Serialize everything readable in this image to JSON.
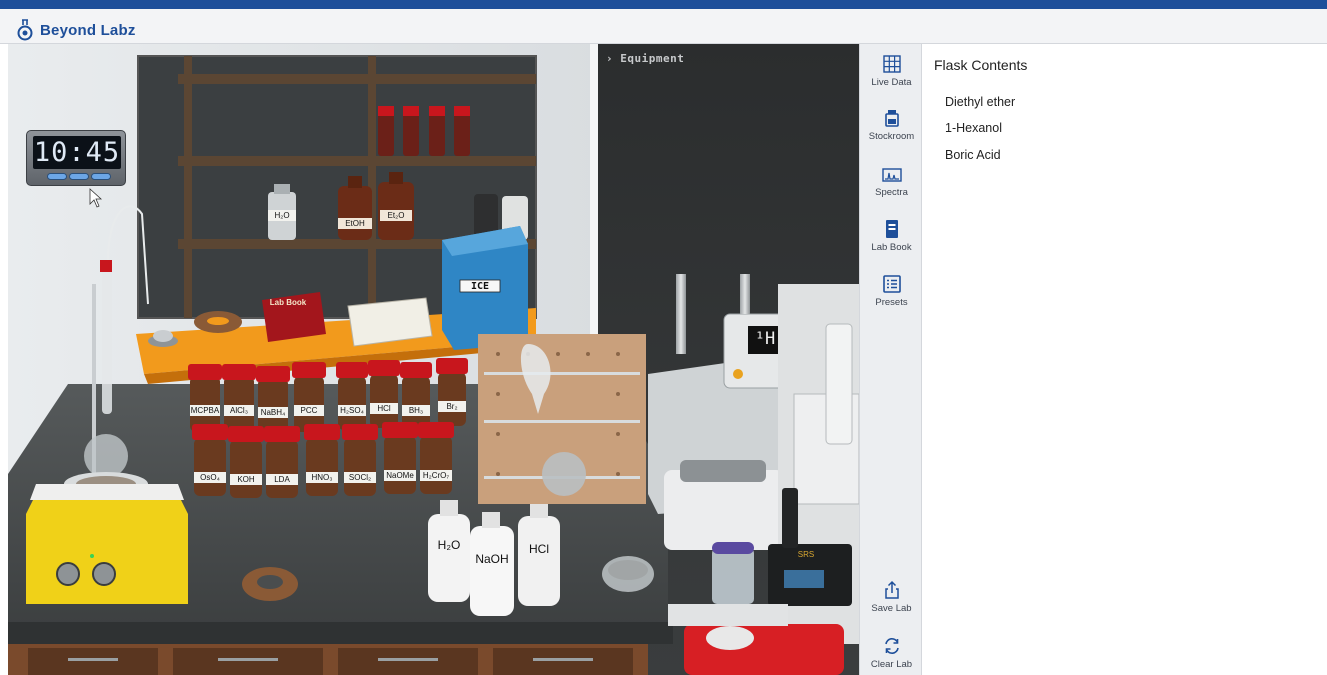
{
  "app": {
    "brand": "Beyond Labz"
  },
  "scene": {
    "equipment_label": "› Equipment",
    "timer": "10:45",
    "lab_book_label": "Lab Book",
    "ice_label": "ICE",
    "nmr_label": "¹H",
    "balance_label": "SRS",
    "shelf_bottles": [
      "H₂O",
      "EtOH",
      "Et₂O"
    ],
    "reagents_top": [
      "MCPBA",
      "AlCl₃",
      "NaBH₄",
      "PCC",
      "H₂SO₄",
      "HCl",
      "BH₃",
      "Br₂"
    ],
    "reagents_bottom": [
      "OsO₄",
      "KOH",
      "LDA",
      "HNO₃",
      "SOCl₂",
      "NaOMe",
      "H₂CrO₇"
    ],
    "wash_bottles": [
      "H₂O",
      "NaOH",
      "HCl"
    ]
  },
  "sidebar": {
    "items": [
      {
        "label": "Live Data",
        "icon": "grid-icon"
      },
      {
        "label": "Stockroom",
        "icon": "bottle-icon"
      },
      {
        "label": "Spectra",
        "icon": "spectrum-icon"
      },
      {
        "label": "Lab Book",
        "icon": "book-icon"
      },
      {
        "label": "Presets",
        "icon": "list-icon"
      }
    ],
    "bottom": [
      {
        "label": "Save Lab",
        "icon": "share-icon"
      },
      {
        "label": "Clear Lab",
        "icon": "refresh-icon"
      }
    ]
  },
  "panel": {
    "title": "Flask Contents",
    "items": [
      "Diethyl ether",
      "1-Hexanol",
      "Boric Acid"
    ]
  },
  "colors": {
    "brand": "#1e4f9a",
    "cap_red": "#c8161d",
    "bench_orange": "#f29a1c",
    "ice_blue": "#2f86c5"
  }
}
